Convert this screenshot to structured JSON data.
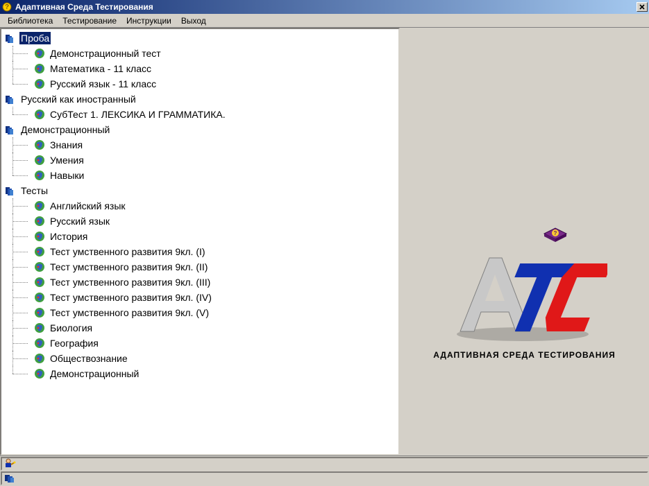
{
  "window": {
    "title": "Адаптивная Среда Тестирования"
  },
  "menu": {
    "items": [
      "Библиотека",
      "Тестирование",
      "Инструкции",
      "Выход"
    ]
  },
  "tree": {
    "folders": [
      {
        "label": "Проба",
        "selected": true,
        "children": [
          "Демонстрационный тест",
          "Математика - 11 класс",
          "Русский язык - 11 класс"
        ]
      },
      {
        "label": "Русский как иностранный",
        "selected": false,
        "children": [
          "СубТест 1. ЛЕКСИКА И ГРАММАТИКА."
        ]
      },
      {
        "label": "Демонстрационный",
        "selected": false,
        "children": [
          "Знания",
          "Умения",
          "Навыки"
        ]
      },
      {
        "label": "Тесты",
        "selected": false,
        "children": [
          "Английский язык",
          "Русский язык",
          "История",
          "Тест умственного развития 9кл. (I)",
          "Тест умственного развития 9кл. (II)",
          "Тест умственного развития 9кл. (III)",
          "Тест умственного развития 9кл. (IV)",
          "Тест умственного развития 9кл. (V)",
          "Биология",
          "География",
          "Обществознание",
          "Демонстрационный"
        ]
      }
    ]
  },
  "logo": {
    "caption": "АДАПТИВНАЯ СРЕДА ТЕСТИРОВАНИЯ"
  }
}
